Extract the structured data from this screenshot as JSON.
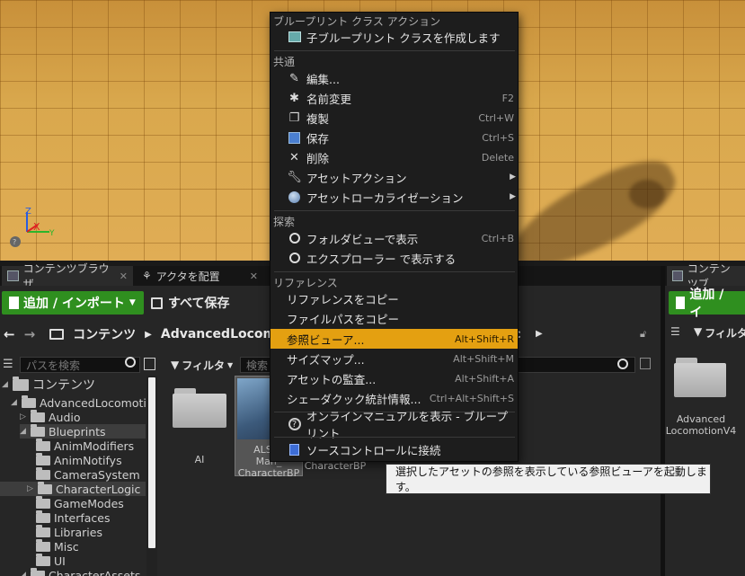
{
  "viewport": {
    "axis_labels": {
      "z": "Z",
      "x": "X",
      "y": "Y"
    }
  },
  "tabs": {
    "content_browser": "コンテンツブラウザ",
    "place_actors": "アクタを配置",
    "content_browser_2": "コンテンツブ"
  },
  "toolbar": {
    "add_import": "追加 / インポート",
    "save_all": "すべて保存",
    "add_import_2": "追加 / イ"
  },
  "path": {
    "root": "コンテンツ",
    "folder": "AdvancedLocomo",
    "tail": "c"
  },
  "search": {
    "path_placeholder": "パスを検索",
    "filter_label": "フィルタ",
    "asset_search_placeholder": "検索",
    "filter_label_2": "フィルタ"
  },
  "tree": {
    "root": "コンテンツ",
    "items": [
      "AdvancedLocomotion",
      "Audio",
      "Blueprints",
      "AnimModifiers",
      "AnimNotifys",
      "CameraSystem",
      "CharacterLogic",
      "GameModes",
      "Interfaces",
      "Libraries",
      "Misc",
      "UI",
      "CharacterAssets"
    ]
  },
  "assets": {
    "ai_label": "AI",
    "bp_label_1": "ALS_A",
    "bp_label_2": "Man_",
    "bp_label_3": "CharacterBP",
    "character_bp": "CharacterBP",
    "right_folder_label": "Advanced LocomotionV4"
  },
  "menu": {
    "section_bp": "ブループリント クラス アクション",
    "create_child": "子ブループリント クラスを作成します",
    "section_common": "共通",
    "edit": "編集...",
    "rename": "名前変更",
    "rename_sc": "F2",
    "duplicate": "複製",
    "duplicate_sc": "Ctrl+W",
    "save": "保存",
    "save_sc": "Ctrl+S",
    "delete": "削除",
    "delete_sc": "Delete",
    "asset_actions": "アセットアクション",
    "asset_localization": "アセットローカライゼーション",
    "section_explore": "探索",
    "show_folder_view": "フォルダビューで表示",
    "show_folder_view_sc": "Ctrl+B",
    "show_explorer": "エクスプローラー で表示する",
    "section_refs": "リファレンス",
    "copy_ref": "リファレンスをコピー",
    "copy_path": "ファイルパスをコピー",
    "ref_viewer": "参照ビューア...",
    "ref_viewer_sc": "Alt+Shift+R",
    "size_map": "サイズマップ...",
    "size_map_sc": "Alt+Shift+M",
    "audit": "アセットの監査...",
    "audit_sc": "Alt+Shift+A",
    "shader_stats": "シェーダクック統計情報...",
    "shader_stats_sc": "Ctrl+Alt+Shift+S",
    "online_manual": "オンラインマニュアルを表示 - ブループリント",
    "source_control": "ソースコントロールに接続"
  },
  "tooltip": "選択したアセットの参照を表示している参照ビューアを起動します。"
}
